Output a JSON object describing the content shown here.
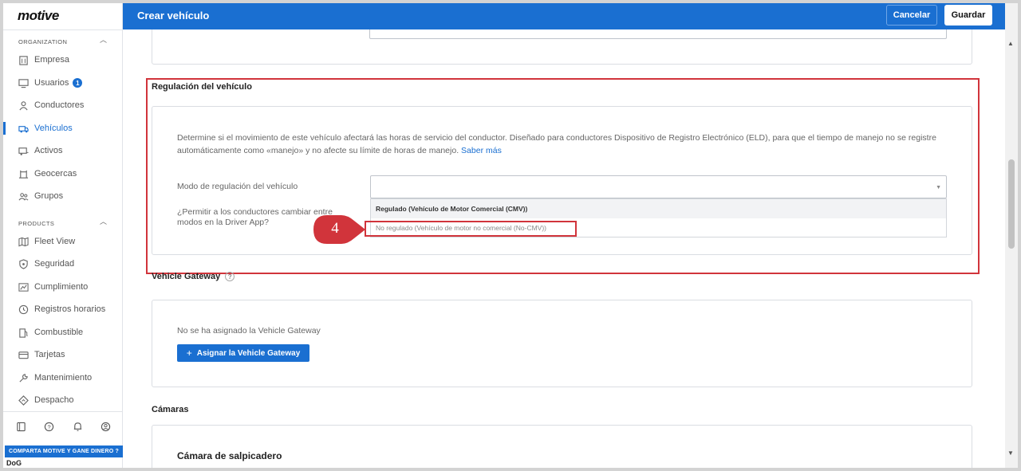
{
  "app": {
    "logo": "motive"
  },
  "header": {
    "title": "Crear vehículo",
    "cancel": "Cancelar",
    "save": "Guardar"
  },
  "sidebar": {
    "organization_label": "ORGANIZATION",
    "products_label": "PRODUCTS",
    "org_items": [
      {
        "label": "Empresa",
        "icon": "building-icon"
      },
      {
        "label": "Usuarios",
        "icon": "monitor-icon",
        "badge": "1"
      },
      {
        "label": "Conductores",
        "icon": "user-icon"
      },
      {
        "label": "Vehículos",
        "icon": "truck-icon",
        "active": true
      },
      {
        "label": "Activos",
        "icon": "trailer-icon"
      },
      {
        "label": "Geocercas",
        "icon": "geofence-icon"
      },
      {
        "label": "Grupos",
        "icon": "group-icon"
      }
    ],
    "product_items": [
      {
        "label": "Fleet View",
        "icon": "map-icon"
      },
      {
        "label": "Seguridad",
        "icon": "shield-icon"
      },
      {
        "label": "Cumplimiento",
        "icon": "chart-icon"
      },
      {
        "label": "Registros horarios",
        "icon": "clock-icon"
      },
      {
        "label": "Combustible",
        "icon": "fuel-icon"
      },
      {
        "label": "Tarjetas",
        "icon": "card-icon"
      },
      {
        "label": "Mantenimiento",
        "icon": "wrench-icon"
      },
      {
        "label": "Despacho",
        "icon": "dispatch-icon"
      }
    ],
    "promo": "COMPARTA MOTIVE Y GANE DINERO ?",
    "promo_logo": "DoG"
  },
  "regulation": {
    "title": "Regulación del vehículo",
    "description": "Determine si el movimiento de este vehículo afectará las horas de servicio del conductor. Diseñado para conductores Dispositivo de Registro Electrónico (ELD), para que el tiempo de manejo no se registre automáticamente como «manejo» y no afecte su límite de horas de manejo.",
    "learn_more": "Saber más",
    "mode_label": "Modo de regulación del vehículo",
    "mode_value": "",
    "allow_label": "¿Permitir a los conductores cambiar entre modos en la Driver App?",
    "options": [
      "Regulado (Vehículo de Motor Comercial (CMV))",
      "No regulado (Vehículo de motor no comercial (No-CMV))"
    ],
    "step_number": "4"
  },
  "gateway": {
    "title": "Vehicle Gateway",
    "empty_text": "No se ha asignado la Vehicle Gateway",
    "assign_button": "Asignar la Vehicle Gateway"
  },
  "cameras": {
    "title": "Cámaras",
    "dashcam_title": "Cámara de salpicadero"
  },
  "colors": {
    "primary": "#1a6fd1",
    "highlight": "#d1343b"
  }
}
